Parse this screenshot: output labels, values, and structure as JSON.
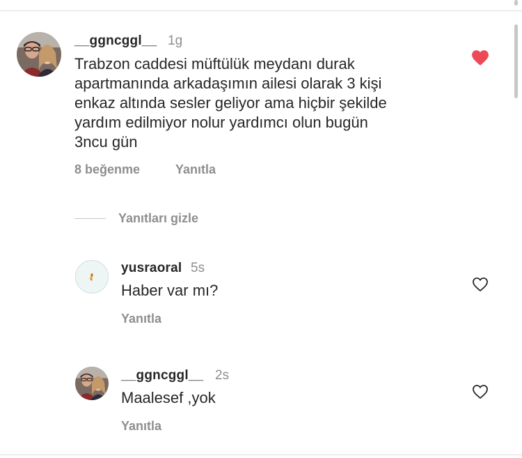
{
  "comment": {
    "username": "__ggncggl__",
    "time": "1g",
    "lines": [
      "Trabzon caddesi müftülük meydanı durak",
      "apartmanında arkadaşımın ailesi olarak 3 kişi",
      "enkaz altında sesler geliyor ama hiçbir şekilde",
      "yardım edilmiyor nolur yardımcı olun bugün",
      "3ncu gün"
    ],
    "likes": "8 beğenme",
    "reply": "Yanıtla",
    "liked": true,
    "heart_color": "#ed4956"
  },
  "hide_replies": "Yanıtları gizle",
  "replies": [
    {
      "username": "yusraoral",
      "time": "5s",
      "text": "Haber var mı?",
      "reply": "Yanıtla",
      "liked": false
    },
    {
      "username": "__ggncggl__",
      "time": "2s",
      "text": "Maalesef ,yok",
      "reply": "Yanıtla",
      "liked": false
    }
  ]
}
